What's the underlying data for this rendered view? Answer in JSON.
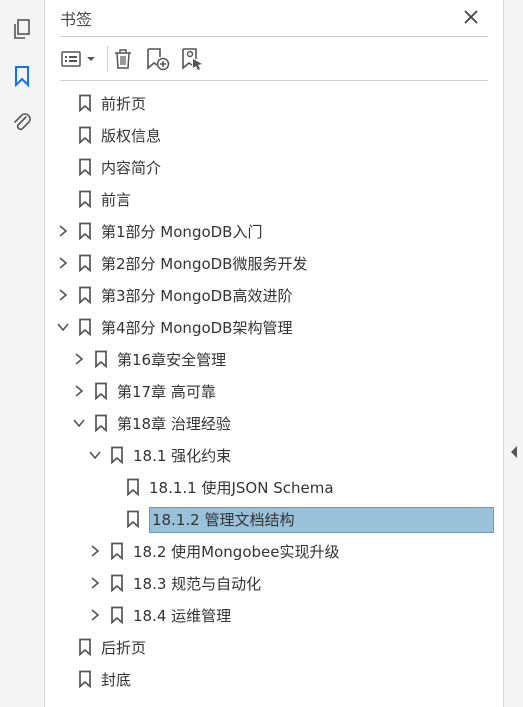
{
  "rail": {
    "icons": [
      "pages-icon",
      "bookmark-icon",
      "attachment-icon"
    ],
    "accent": "#1473e6"
  },
  "panel": {
    "title": "书签",
    "close_icon": "close-icon"
  },
  "toolbar": {
    "items": [
      "options-menu-icon",
      "delete-icon",
      "new-bookmark-icon",
      "new-bookmark-from-structure-icon"
    ]
  },
  "bookmarks": [
    {
      "label": "前折页",
      "level": 0,
      "expander": "none"
    },
    {
      "label": "版权信息",
      "level": 0,
      "expander": "none"
    },
    {
      "label": "内容简介",
      "level": 0,
      "expander": "none"
    },
    {
      "label": "前言",
      "level": 0,
      "expander": "none"
    },
    {
      "label": "第1部分 MongoDB入门",
      "level": 0,
      "expander": "collapsed"
    },
    {
      "label": "第2部分 MongoDB微服务开发",
      "level": 0,
      "expander": "collapsed"
    },
    {
      "label": "第3部分 MongoDB高效进阶",
      "level": 0,
      "expander": "collapsed"
    },
    {
      "label": "第4部分 MongoDB架构管理",
      "level": 0,
      "expander": "expanded"
    },
    {
      "label": "第16章安全管理",
      "level": 1,
      "expander": "collapsed"
    },
    {
      "label": "第17章 高可靠",
      "level": 1,
      "expander": "collapsed"
    },
    {
      "label": "第18章 治理经验",
      "level": 1,
      "expander": "expanded"
    },
    {
      "label": "18.1 强化约束",
      "level": 2,
      "expander": "expanded"
    },
    {
      "label": "18.1.1 使用JSON Schema",
      "level": 3,
      "expander": "none"
    },
    {
      "label": "18.1.2 管理文档结构",
      "level": 3,
      "expander": "none",
      "selected": true
    },
    {
      "label": "18.2 使用Mongobee实现升级",
      "level": 2,
      "expander": "collapsed"
    },
    {
      "label": "18.3 规范与自动化",
      "level": 2,
      "expander": "collapsed"
    },
    {
      "label": "18.4 运维管理",
      "level": 2,
      "expander": "collapsed"
    },
    {
      "label": "后折页",
      "level": 0,
      "expander": "none"
    },
    {
      "label": "封底",
      "level": 0,
      "expander": "none"
    }
  ],
  "colors": {
    "selection": "#99c1da",
    "icon": "#555555"
  }
}
